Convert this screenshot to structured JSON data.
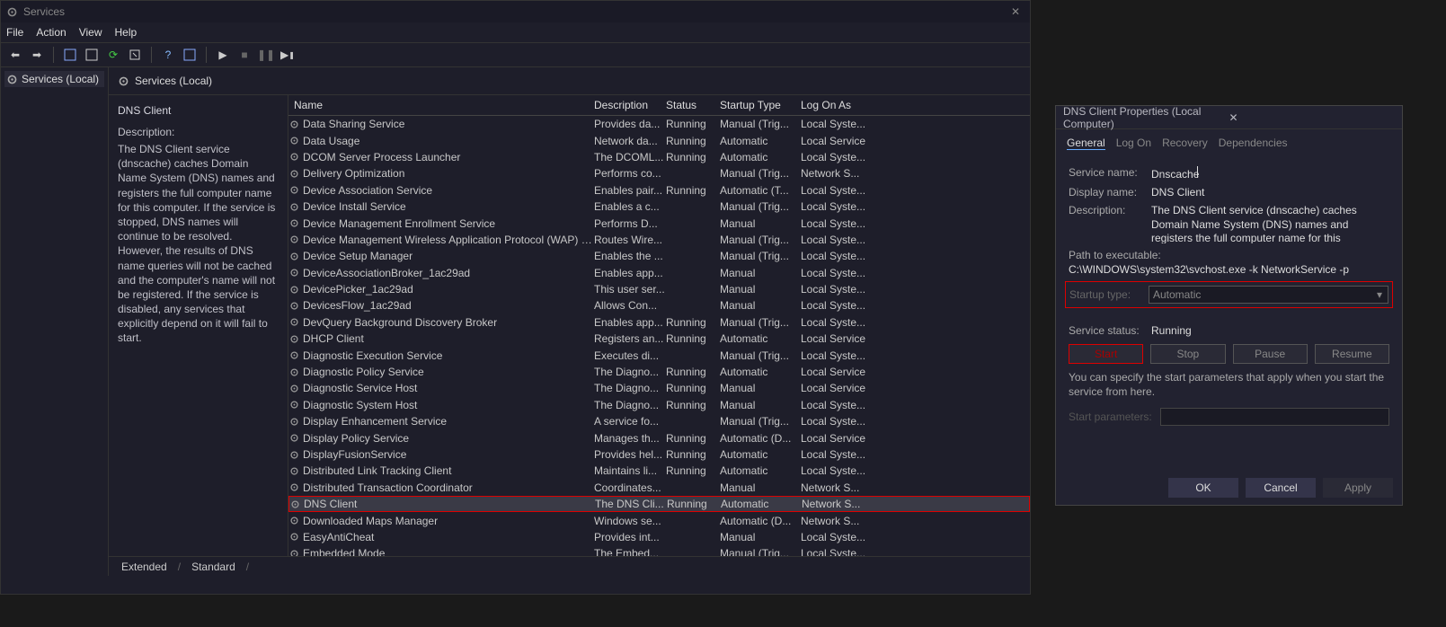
{
  "window": {
    "title": "Services"
  },
  "menu": {
    "file": "File",
    "action": "Action",
    "view": "View",
    "help": "Help"
  },
  "tree": {
    "root": "Services (Local)"
  },
  "mainHeader": "Services (Local)",
  "detail": {
    "title": "DNS Client",
    "descLabel": "Description:",
    "desc": "The DNS Client service (dnscache) caches Domain Name System (DNS) names and registers the full computer name for this computer. If the service is stopped, DNS names will continue to be resolved. However, the results of DNS name queries will not be cached and the computer's name will not be registered. If the service is disabled, any services that explicitly depend on it will fail to start."
  },
  "columns": {
    "name": "Name",
    "description": "Description",
    "status": "Status",
    "startup": "Startup Type",
    "logon": "Log On As"
  },
  "rows": [
    {
      "name": "Data Sharing Service",
      "desc": "Provides da...",
      "status": "Running",
      "startup": "Manual (Trig...",
      "logon": "Local Syste..."
    },
    {
      "name": "Data Usage",
      "desc": "Network da...",
      "status": "Running",
      "startup": "Automatic",
      "logon": "Local Service"
    },
    {
      "name": "DCOM Server Process Launcher",
      "desc": "The DCOML...",
      "status": "Running",
      "startup": "Automatic",
      "logon": "Local Syste..."
    },
    {
      "name": "Delivery Optimization",
      "desc": "Performs co...",
      "status": "",
      "startup": "Manual (Trig...",
      "logon": "Network S..."
    },
    {
      "name": "Device Association Service",
      "desc": "Enables pair...",
      "status": "Running",
      "startup": "Automatic (T...",
      "logon": "Local Syste..."
    },
    {
      "name": "Device Install Service",
      "desc": "Enables a c...",
      "status": "",
      "startup": "Manual (Trig...",
      "logon": "Local Syste..."
    },
    {
      "name": "Device Management Enrollment Service",
      "desc": "Performs D...",
      "status": "",
      "startup": "Manual",
      "logon": "Local Syste..."
    },
    {
      "name": "Device Management Wireless Application Protocol (WAP) P...",
      "desc": "Routes Wire...",
      "status": "",
      "startup": "Manual (Trig...",
      "logon": "Local Syste..."
    },
    {
      "name": "Device Setup Manager",
      "desc": "Enables the ...",
      "status": "",
      "startup": "Manual (Trig...",
      "logon": "Local Syste..."
    },
    {
      "name": "DeviceAssociationBroker_1ac29ad",
      "desc": "Enables app...",
      "status": "",
      "startup": "Manual",
      "logon": "Local Syste..."
    },
    {
      "name": "DevicePicker_1ac29ad",
      "desc": "This user ser...",
      "status": "",
      "startup": "Manual",
      "logon": "Local Syste..."
    },
    {
      "name": "DevicesFlow_1ac29ad",
      "desc": "Allows Con...",
      "status": "",
      "startup": "Manual",
      "logon": "Local Syste..."
    },
    {
      "name": "DevQuery Background Discovery Broker",
      "desc": "Enables app...",
      "status": "Running",
      "startup": "Manual (Trig...",
      "logon": "Local Syste..."
    },
    {
      "name": "DHCP Client",
      "desc": "Registers an...",
      "status": "Running",
      "startup": "Automatic",
      "logon": "Local Service"
    },
    {
      "name": "Diagnostic Execution Service",
      "desc": "Executes di...",
      "status": "",
      "startup": "Manual (Trig...",
      "logon": "Local Syste..."
    },
    {
      "name": "Diagnostic Policy Service",
      "desc": "The Diagno...",
      "status": "Running",
      "startup": "Automatic",
      "logon": "Local Service"
    },
    {
      "name": "Diagnostic Service Host",
      "desc": "The Diagno...",
      "status": "Running",
      "startup": "Manual",
      "logon": "Local Service"
    },
    {
      "name": "Diagnostic System Host",
      "desc": "The Diagno...",
      "status": "Running",
      "startup": "Manual",
      "logon": "Local Syste..."
    },
    {
      "name": "Display Enhancement Service",
      "desc": "A service fo...",
      "status": "",
      "startup": "Manual (Trig...",
      "logon": "Local Syste..."
    },
    {
      "name": "Display Policy Service",
      "desc": "Manages th...",
      "status": "Running",
      "startup": "Automatic (D...",
      "logon": "Local Service"
    },
    {
      "name": "DisplayFusionService",
      "desc": "Provides hel...",
      "status": "Running",
      "startup": "Automatic",
      "logon": "Local Syste..."
    },
    {
      "name": "Distributed Link Tracking Client",
      "desc": "Maintains li...",
      "status": "Running",
      "startup": "Automatic",
      "logon": "Local Syste..."
    },
    {
      "name": "Distributed Transaction Coordinator",
      "desc": "Coordinates...",
      "status": "",
      "startup": "Manual",
      "logon": "Network S..."
    },
    {
      "name": "DNS Client",
      "desc": "The DNS Cli...",
      "status": "Running",
      "startup": "Automatic",
      "logon": "Network S...",
      "highlighted": true
    },
    {
      "name": "Downloaded Maps Manager",
      "desc": "Windows se...",
      "status": "",
      "startup": "Automatic (D...",
      "logon": "Network S..."
    },
    {
      "name": "EasyAntiCheat",
      "desc": "Provides int...",
      "status": "",
      "startup": "Manual",
      "logon": "Local Syste..."
    },
    {
      "name": "Embedded Mode",
      "desc": "The Embed...",
      "status": "",
      "startup": "Manual (Trig...",
      "logon": "Local Syste..."
    }
  ],
  "tabs": {
    "extended": "Extended",
    "standard": "Standard"
  },
  "props": {
    "title": "DNS Client Properties (Local Computer)",
    "tabs": {
      "general": "General",
      "logon": "Log On",
      "recovery": "Recovery",
      "dependencies": "Dependencies"
    },
    "serviceNameLabel": "Service name:",
    "serviceName": "Dnscache",
    "displayNameLabel": "Display name:",
    "displayName": "DNS Client",
    "descLabel": "Description:",
    "desc": "The DNS Client service (dnscache) caches Domain Name System (DNS) names and registers the full computer name for this computer. If the service is",
    "pathLabel": "Path to executable:",
    "path": "C:\\WINDOWS\\system32\\svchost.exe -k NetworkService -p",
    "startupLabel": "Startup type:",
    "startupValue": "Automatic",
    "statusLabel": "Service status:",
    "statusValue": "Running",
    "btnStart": "Start",
    "btnStop": "Stop",
    "btnPause": "Pause",
    "btnResume": "Resume",
    "hint": "You can specify the start parameters that apply when you start the service from here.",
    "paramLabel": "Start parameters:",
    "btnOk": "OK",
    "btnCancel": "Cancel",
    "btnApply": "Apply"
  }
}
